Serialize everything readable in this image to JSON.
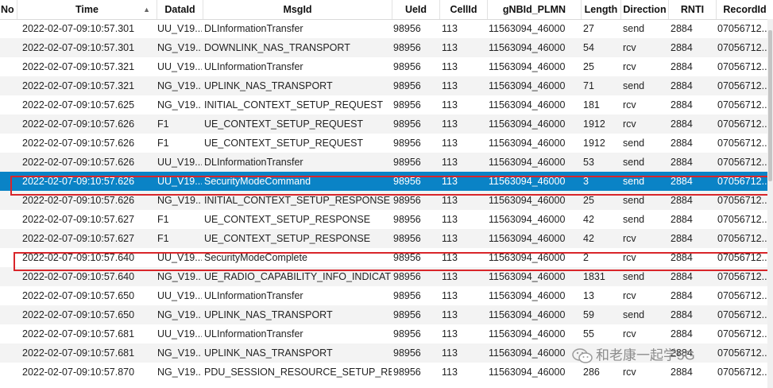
{
  "columns": {
    "no": "No",
    "time": "Time",
    "dataid": "DataId",
    "msgid": "MsgId",
    "ueid": "UeId",
    "cellid": "CellId",
    "gnbid": "gNBId_PLMN",
    "length": "Length",
    "direction": "Direction",
    "rnti": "RNTI",
    "recordid": "RecordId"
  },
  "rows": [
    {
      "time": "2022-02-07-09:10:57.301",
      "dataid": "UU_V19...",
      "msgid": "DLInformationTransfer",
      "ueid": "98956",
      "cellid": "113",
      "gnbid": "11563094_46000",
      "length": "27",
      "direction": "send",
      "rnti": "2884",
      "recordid": "07056712..."
    },
    {
      "time": "2022-02-07-09:10:57.301",
      "dataid": "NG_V19...",
      "msgid": "DOWNLINK_NAS_TRANSPORT",
      "ueid": "98956",
      "cellid": "113",
      "gnbid": "11563094_46000",
      "length": "54",
      "direction": "rcv",
      "rnti": "2884",
      "recordid": "07056712..."
    },
    {
      "time": "2022-02-07-09:10:57.321",
      "dataid": "UU_V19...",
      "msgid": "ULInformationTransfer",
      "ueid": "98956",
      "cellid": "113",
      "gnbid": "11563094_46000",
      "length": "25",
      "direction": "rcv",
      "rnti": "2884",
      "recordid": "07056712..."
    },
    {
      "time": "2022-02-07-09:10:57.321",
      "dataid": "NG_V19...",
      "msgid": "UPLINK_NAS_TRANSPORT",
      "ueid": "98956",
      "cellid": "113",
      "gnbid": "11563094_46000",
      "length": "71",
      "direction": "send",
      "rnti": "2884",
      "recordid": "07056712..."
    },
    {
      "time": "2022-02-07-09:10:57.625",
      "dataid": "NG_V19...",
      "msgid": "INITIAL_CONTEXT_SETUP_REQUEST",
      "ueid": "98956",
      "cellid": "113",
      "gnbid": "11563094_46000",
      "length": "181",
      "direction": "rcv",
      "rnti": "2884",
      "recordid": "07056712..."
    },
    {
      "time": "2022-02-07-09:10:57.626",
      "dataid": "F1",
      "msgid": "UE_CONTEXT_SETUP_REQUEST",
      "ueid": "98956",
      "cellid": "113",
      "gnbid": "11563094_46000",
      "length": "1912",
      "direction": "rcv",
      "rnti": "2884",
      "recordid": "07056712..."
    },
    {
      "time": "2022-02-07-09:10:57.626",
      "dataid": "F1",
      "msgid": "UE_CONTEXT_SETUP_REQUEST",
      "ueid": "98956",
      "cellid": "113",
      "gnbid": "11563094_46000",
      "length": "1912",
      "direction": "send",
      "rnti": "2884",
      "recordid": "07056712..."
    },
    {
      "time": "2022-02-07-09:10:57.626",
      "dataid": "UU_V19...",
      "msgid": "DLInformationTransfer",
      "ueid": "98956",
      "cellid": "113",
      "gnbid": "11563094_46000",
      "length": "53",
      "direction": "send",
      "rnti": "2884",
      "recordid": "07056712..."
    },
    {
      "time": "2022-02-07-09:10:57.626",
      "dataid": "UU_V19...",
      "msgid": "SecurityModeCommand",
      "ueid": "98956",
      "cellid": "113",
      "gnbid": "11563094_46000",
      "length": "3",
      "direction": "send",
      "rnti": "2884",
      "recordid": "07056712..."
    },
    {
      "time": "2022-02-07-09:10:57.626",
      "dataid": "NG_V19...",
      "msgid": "INITIAL_CONTEXT_SETUP_RESPONSE",
      "ueid": "98956",
      "cellid": "113",
      "gnbid": "11563094_46000",
      "length": "25",
      "direction": "send",
      "rnti": "2884",
      "recordid": "07056712..."
    },
    {
      "time": "2022-02-07-09:10:57.627",
      "dataid": "F1",
      "msgid": "UE_CONTEXT_SETUP_RESPONSE",
      "ueid": "98956",
      "cellid": "113",
      "gnbid": "11563094_46000",
      "length": "42",
      "direction": "send",
      "rnti": "2884",
      "recordid": "07056712..."
    },
    {
      "time": "2022-02-07-09:10:57.627",
      "dataid": "F1",
      "msgid": "UE_CONTEXT_SETUP_RESPONSE",
      "ueid": "98956",
      "cellid": "113",
      "gnbid": "11563094_46000",
      "length": "42",
      "direction": "rcv",
      "rnti": "2884",
      "recordid": "07056712..."
    },
    {
      "time": "2022-02-07-09:10:57.640",
      "dataid": "UU_V19...",
      "msgid": "SecurityModeComplete",
      "ueid": "98956",
      "cellid": "113",
      "gnbid": "11563094_46000",
      "length": "2",
      "direction": "rcv",
      "rnti": "2884",
      "recordid": "07056712..."
    },
    {
      "time": "2022-02-07-09:10:57.640",
      "dataid": "NG_V19...",
      "msgid": "UE_RADIO_CAPABILITY_INFO_INDICATI...",
      "ueid": "98956",
      "cellid": "113",
      "gnbid": "11563094_46000",
      "length": "1831",
      "direction": "send",
      "rnti": "2884",
      "recordid": "07056712..."
    },
    {
      "time": "2022-02-07-09:10:57.650",
      "dataid": "UU_V19...",
      "msgid": "ULInformationTransfer",
      "ueid": "98956",
      "cellid": "113",
      "gnbid": "11563094_46000",
      "length": "13",
      "direction": "rcv",
      "rnti": "2884",
      "recordid": "07056712..."
    },
    {
      "time": "2022-02-07-09:10:57.650",
      "dataid": "NG_V19...",
      "msgid": "UPLINK_NAS_TRANSPORT",
      "ueid": "98956",
      "cellid": "113",
      "gnbid": "11563094_46000",
      "length": "59",
      "direction": "send",
      "rnti": "2884",
      "recordid": "07056712..."
    },
    {
      "time": "2022-02-07-09:10:57.681",
      "dataid": "UU_V19...",
      "msgid": "ULInformationTransfer",
      "ueid": "98956",
      "cellid": "113",
      "gnbid": "11563094_46000",
      "length": "55",
      "direction": "rcv",
      "rnti": "2884",
      "recordid": "07056712..."
    },
    {
      "time": "2022-02-07-09:10:57.681",
      "dataid": "NG_V19...",
      "msgid": "UPLINK_NAS_TRANSPORT",
      "ueid": "98956",
      "cellid": "113",
      "gnbid": "11563094_46000",
      "length": "",
      "direction": "",
      "rnti": "2884",
      "recordid": "07056712..."
    },
    {
      "time": "2022-02-07-09:10:57.870",
      "dataid": "NG_V19...",
      "msgid": "PDU_SESSION_RESOURCE_SETUP_REQ...",
      "ueid": "98956",
      "cellid": "113",
      "gnbid": "11563094_46000",
      "length": "286",
      "direction": "rcv",
      "rnti": "2884",
      "recordid": "07056712..."
    }
  ],
  "selected_row_index": 8,
  "highlighted_row_indices": [
    8,
    12
  ],
  "highlight_color": "#d9252a",
  "selection_color": "#0a83c6",
  "sort_indicator": "▲",
  "watermark": {
    "text": "和老康一起学5G",
    "icon": "wechat-icon"
  }
}
